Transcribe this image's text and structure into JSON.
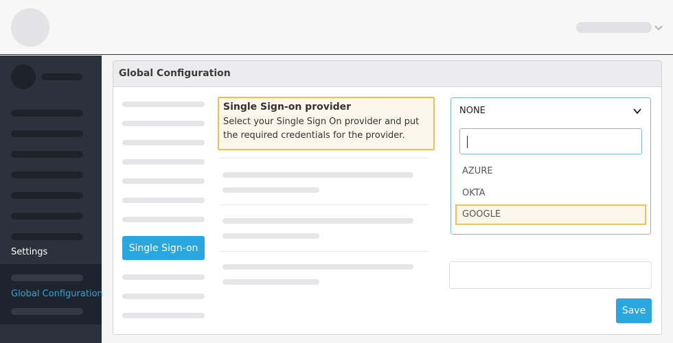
{
  "header": {
    "user_menu_icon": "chevron-down-icon"
  },
  "sidebar": {
    "section_label": "Settings",
    "active_item": "Global Configuration"
  },
  "panel": {
    "title": "Global Configuration",
    "nav_button": "Single Sign-on",
    "save_label": "Save"
  },
  "provider": {
    "title": "Single Sign-on provider",
    "description": "Select your Single Sign On provider and put the required credentials for the provider."
  },
  "dropdown": {
    "selected": "NONE",
    "search_value": "",
    "options": [
      "AZURE",
      "OKTA",
      "GOOGLE"
    ],
    "highlighted": "GOOGLE"
  },
  "colors": {
    "accent": "#2aa7e0",
    "highlight_border": "#f0c052",
    "sidebar_bg": "#2b323c"
  }
}
